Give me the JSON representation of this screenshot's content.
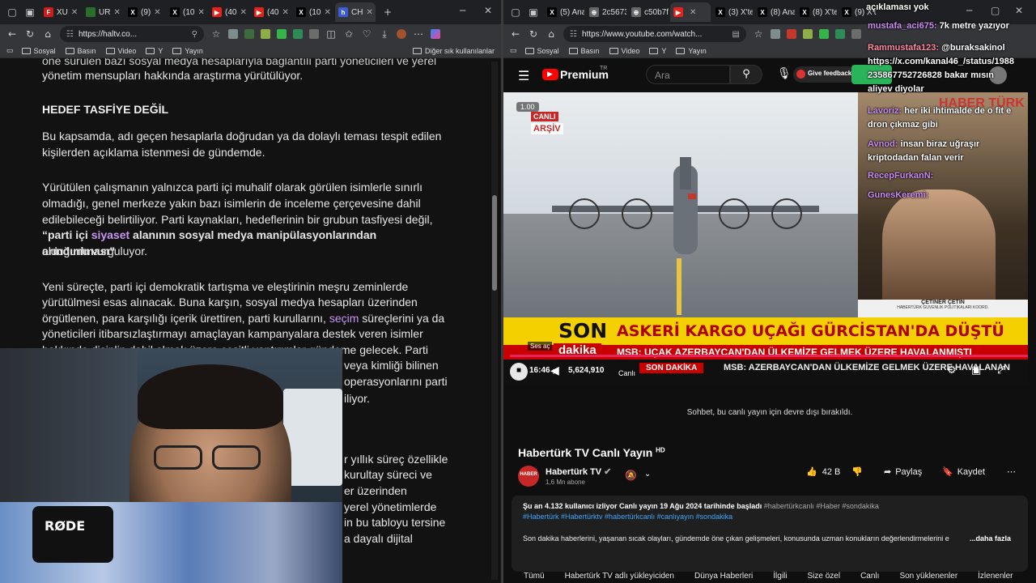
{
  "left_browser": {
    "tabs": [
      {
        "label": "XU",
        "favicon_color": "#d11a1a",
        "favicon_letter": "F"
      },
      {
        "label": "UR",
        "favicon_color": "#2a6e2a",
        "favicon_letter": ""
      },
      {
        "label": "(9)",
        "favicon_color": "#000000",
        "favicon_letter": "X"
      },
      {
        "label": "(10",
        "favicon_color": "#000000",
        "favicon_letter": "X"
      },
      {
        "label": "(40",
        "favicon_color": "#e62117",
        "favicon_letter": "▶"
      },
      {
        "label": "(40",
        "favicon_color": "#e62117",
        "favicon_letter": "▶"
      },
      {
        "label": "(10",
        "favicon_color": "#000000",
        "favicon_letter": "X"
      },
      {
        "label": "CH",
        "favicon_color": "#3b5bdb",
        "favicon_letter": "h"
      }
    ],
    "url": "https://haltv.co...",
    "bookmarks": [
      "Sosyal",
      "Basın",
      "Video",
      "Y",
      "Yayın"
    ],
    "other_bookmarks": "Diğer sık kullanılanlar"
  },
  "article": {
    "top_fragment": "öne sürülen bazı sosyal medya hesaplarıyla bağlantılı parti yöneticileri ve yerel",
    "p0": "yönetim mensupları hakkında araştırma yürütülüyor.",
    "heading": "HEDEF TASFİYE DEĞİL",
    "p1_l1": "Bu kapsamda, adı geçen hesaplarla doğrudan ya da dolaylı teması tespit edilen",
    "p1_l2": "kişilerden açıklama istenmesi de gündemde.",
    "p2_l1": "Yürütülen çalışmanın yalnızca parti içi muhalif olarak görülen isimlerle sınırlı",
    "p2_l2": "olmadığı, genel merkeze yakın bazı isimlerin de inceleme çerçevesine dahil",
    "p2_l3": "edilebileceği belirtiliyor. Parti kaynakları, hedeflerinin bir grubun tasfiyesi değil,",
    "p2_l4_a": "“parti içi ",
    "p2_l4_link": "siyaset",
    "p2_l4_b": " alanının sosyal medya manipülasyonlarından arındırılması”",
    "p2_l5": "olduğunu vurguluyor.",
    "p3_l1": "Yeni süreçte, parti içi demokratik tartışma ve eleştirinin meşru zeminlerde",
    "p3_l2": "yürütülmesi esas alınacak. Buna karşın, sosyal medya hesapları üzerinden",
    "p3_l3_a": "örgütlenen, para karşılığı içerik ürettiren, parti kurullarını, ",
    "p3_l3_link": "seçim",
    "p3_l3_b": " süreçlerini ya da",
    "p3_l4": "yöneticileri itibarsızlaştırmayı amaçlayan kampanyalara destek veren isimler",
    "p3_l5": "hakkında disiplin dahil olmak üzere çeşitli yaptırımlar gündeme gelecek. Parti",
    "p3_frag1": "veya kimliği bilinen",
    "p3_frag2": "operasyonlarını parti",
    "p3_frag3": "iliyor.",
    "p4_frag1": "r yıllık süreç özellikle",
    "p4_frag2": "kurultay süreci ve",
    "p4_frag3": "er üzerinden",
    "p4_frag4": "yerel yönetimlerde",
    "p4_frag5": "in bu tabloyu tersine",
    "p4_frag6": "a dayalı dijital"
  },
  "webcam": {
    "mic_brand": "RØDE"
  },
  "right_browser": {
    "tabs": [
      {
        "label": "(5) Ana",
        "favicon_color": "#000000",
        "favicon_letter": "X"
      },
      {
        "label": "2c5673",
        "favicon_color": "#666666",
        "favicon_letter": "⊕"
      },
      {
        "label": "c50b7f",
        "favicon_color": "#666666",
        "favicon_letter": "⊕"
      },
      {
        "label": "",
        "favicon_color": "#e62117",
        "favicon_letter": "▶"
      },
      {
        "label": "(3) X'te",
        "favicon_color": "#000000",
        "favicon_letter": "X"
      },
      {
        "label": "(8) Ana",
        "favicon_color": "#000000",
        "favicon_letter": "X"
      },
      {
        "label": "(8) X'te",
        "favicon_color": "#000000",
        "favicon_letter": "X"
      },
      {
        "label": "(9) X't",
        "favicon_color": "#000000",
        "favicon_letter": "X"
      }
    ],
    "url": "https://www.youtube.com/watch...",
    "bookmarks": [
      "Sosyal",
      "Basın",
      "Video",
      "Y",
      "Yayın"
    ]
  },
  "youtube": {
    "logo_text": "Premium",
    "logo_sup": "TR",
    "search_placeholder": "Ara",
    "feedback_label": "Give feedback",
    "speed_badge": "1.00",
    "live_badge": "CANLI",
    "archive_badge": "ARŞİV",
    "guest_name": "ÇETİNER ÇETİN",
    "guest_title": "HABERTÜRK GÜVENLİK POLİTİKALARI KOORD.",
    "son_label": "SON",
    "dakika_label": "dakika",
    "headline": "ASKERİ KARGO UÇAĞI GÜRCİSTAN'DA DÜŞTÜ",
    "subheadline": "MSB: UÇAK AZERBAYCAN'DAN ÜLKEMİZE GELMEK ÜZERE HAVALANMIŞTI",
    "ticker_badge": "SON DAKİKA",
    "ticker_text": "MSB: AZERBAYCAN'DAN ÜLKEMİZE GELMEK ÜZERE HAVALANAN",
    "channel_watermark": "HABER TÜRK",
    "time_label": "16:46",
    "viewer_count": "5,624,910",
    "live_label": "Canlı",
    "volume_label": "Ses aç",
    "chat_disabled": "Sohbet, bu canlı yayın için devre dışı bırakıldı.",
    "video_title": "Habertürk TV Canlı Yayın",
    "video_title_badge": "HD",
    "channel_name": "Habertürk TV",
    "subscribers": "1,6 Mn abone",
    "likes": "42 B",
    "share_label": "Paylaş",
    "save_label": "Kaydet",
    "desc_line1_a": "Şu an 4.132 kullanıcı izliyor  Canlı yayın 19 Ağu 2024 tarihinde başladı",
    "desc_line1_tags": "#habertürkcanlı #Haber #sondakika",
    "desc_line2": "#Habertürk #Habertürktv #habertürkcanlı #canlıyayın #sondakika",
    "desc_line3": "Son dakika haberlerini, yaşanan sıcak olayları, gündemde öne çıkan gelişmeleri, konusunda uzman konukların değerlendirmelerini e",
    "desc_more": "...daha fazla",
    "nav_chips": [
      "Tümü",
      "Habertürk TV adlı yükleyiciden",
      "Dünya Haberleri",
      "İlgili",
      "Size özel",
      "Canlı",
      "Son yüklenenler",
      "İzlenenler"
    ]
  },
  "overlay_chat": [
    {
      "user": "",
      "text": "açıklaması yok",
      "user_color": "#c88bef"
    },
    {
      "user": "mustafa_aci675:",
      "text": "7k metre yazıyor",
      "user_color": "#c88bef"
    },
    {
      "user": "Rammustafa123:",
      "text": "@buraksakinol",
      "user_color": "#ff8aa0"
    },
    {
      "user": "",
      "text": "https://x.com/kanal46_/status/1988",
      "user_color": "#ffffff"
    },
    {
      "user": "",
      "text": "235867752726828 bakar mısın",
      "user_color": "#ffffff"
    },
    {
      "user": "",
      "text": "aliyev diyolar",
      "user_color": "#ffffff"
    },
    {
      "user": "Lavoriz:",
      "text": "her iki ihtimalde de o fit e",
      "user_color": "#c88bef"
    },
    {
      "user": "",
      "text": "dron çıkmaz gibi",
      "user_color": "#ffffff"
    },
    {
      "user": "Avnod:",
      "text": "insan biraz uğraşır",
      "user_color": "#c88bef"
    },
    {
      "user": "",
      "text": "kriptodadan falan verir",
      "user_color": "#ffffff"
    },
    {
      "user": "RecepFurkanN:",
      "text": "",
      "user_color": "#c88bef"
    },
    {
      "user": "GunesKeremi:",
      "text": "",
      "user_color": "#c88bef"
    }
  ]
}
